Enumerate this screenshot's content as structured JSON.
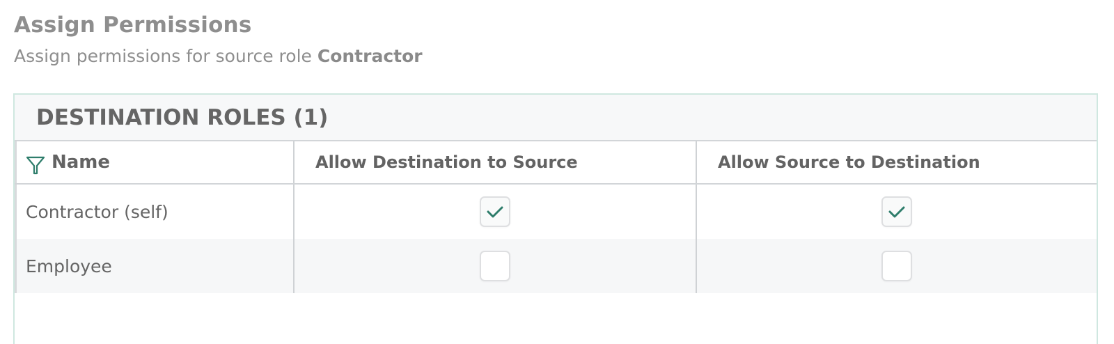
{
  "page": {
    "title": "Assign Permissions",
    "subtitle_prefix": "Assign permissions for source role ",
    "source_role": "Contractor"
  },
  "panel": {
    "header": "DESTINATION ROLES (1)"
  },
  "table": {
    "columns": {
      "name": "Name",
      "dest_to_source": "Allow Destination to Source",
      "source_to_dest": "Allow Source to Destination"
    },
    "rows": [
      {
        "name": "Contractor (self)",
        "dest_to_source": true,
        "source_to_dest": true
      },
      {
        "name": "Employee",
        "dest_to_source": false,
        "source_to_dest": false
      }
    ]
  },
  "colors": {
    "accent": "#2e7d6b",
    "panel_border": "#cfe7e0"
  },
  "icons": {
    "filter": "filter-icon",
    "check": "check-icon"
  }
}
